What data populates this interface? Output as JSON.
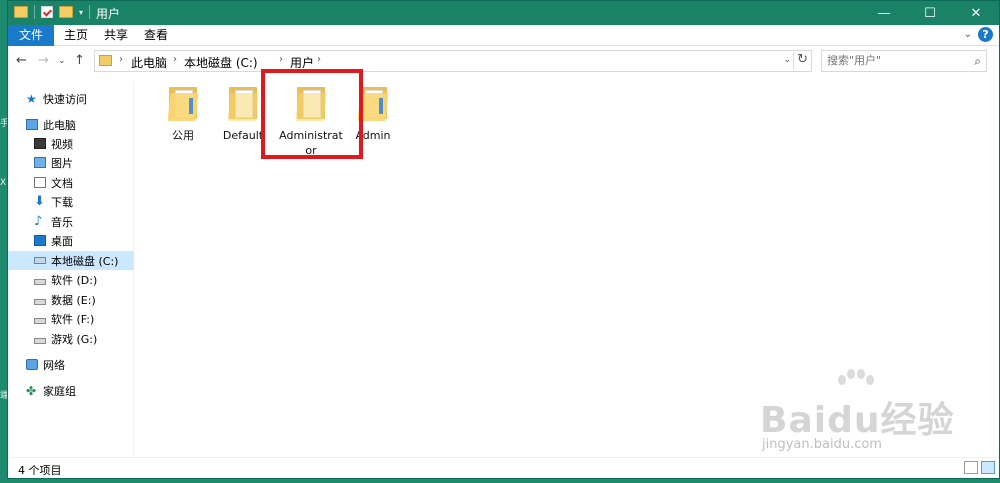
{
  "window": {
    "title": "用户",
    "minimize": "—",
    "maximize": "☐",
    "close": "✕"
  },
  "ribbon": {
    "tabs": [
      {
        "label": "文件"
      },
      {
        "label": "主页"
      },
      {
        "label": "共享"
      },
      {
        "label": "查看"
      }
    ],
    "help": "?"
  },
  "address": {
    "crumbs": [
      "此电脑",
      "本地磁盘 (C:)",
      "用户"
    ],
    "separator": "›"
  },
  "search": {
    "placeholder": "搜索\"用户\""
  },
  "sidebar": {
    "items": [
      {
        "label": "快速访问",
        "icon": "star-icon"
      },
      {
        "label": "此电脑",
        "icon": "computer-icon"
      },
      {
        "label": "视频",
        "icon": "video-icon"
      },
      {
        "label": "图片",
        "icon": "picture-icon"
      },
      {
        "label": "文档",
        "icon": "document-icon"
      },
      {
        "label": "下载",
        "icon": "download-icon"
      },
      {
        "label": "音乐",
        "icon": "music-icon"
      },
      {
        "label": "桌面",
        "icon": "desktop-icon"
      },
      {
        "label": "本地磁盘 (C:)",
        "icon": "drive-icon",
        "selected": true
      },
      {
        "label": "软件 (D:)",
        "icon": "drive-icon"
      },
      {
        "label": "数据 (E:)",
        "icon": "drive-icon"
      },
      {
        "label": "软件 (F:)",
        "icon": "drive-icon"
      },
      {
        "label": "游戏 (G:)",
        "icon": "drive-icon"
      },
      {
        "label": "网络",
        "icon": "network-icon"
      },
      {
        "label": "家庭组",
        "icon": "homegroup-icon"
      }
    ]
  },
  "content": {
    "folders": [
      {
        "label": "公用"
      },
      {
        "label": "Default"
      },
      {
        "label": "Administrator"
      },
      {
        "label": "Admin"
      }
    ]
  },
  "status": {
    "count": "4 个项目"
  },
  "watermark": {
    "text": "Baidu经验",
    "url": "jingyan.baidu.com"
  },
  "colors": {
    "accent": "#1979ca",
    "titlebar": "#1a8266",
    "highlight": "#e0191f",
    "selection": "#cce8ff"
  }
}
